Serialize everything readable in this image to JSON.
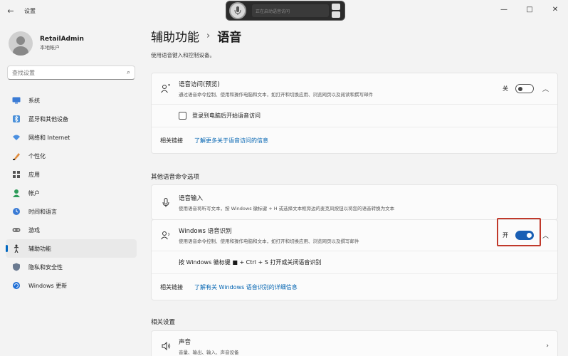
{
  "titlebar": {
    "back_icon": "←",
    "title": "设置",
    "minimize": "—",
    "maximize": "□",
    "close": "✕"
  },
  "voice_access_bar": {
    "status_text": "正在启动语音访问"
  },
  "profile": {
    "name": "RetailAdmin",
    "account_type": "本地帐户"
  },
  "search": {
    "placeholder": "查找设置"
  },
  "nav": {
    "items": [
      {
        "label": "系统",
        "icon": "system-icon"
      },
      {
        "label": "蓝牙和其他设备",
        "icon": "bluetooth-icon"
      },
      {
        "label": "网络和 Internet",
        "icon": "network-icon"
      },
      {
        "label": "个性化",
        "icon": "personalization-icon"
      },
      {
        "label": "应用",
        "icon": "apps-icon"
      },
      {
        "label": "帐户",
        "icon": "account-icon"
      },
      {
        "label": "时间和语言",
        "icon": "time-language-icon"
      },
      {
        "label": "游戏",
        "icon": "gaming-icon"
      },
      {
        "label": "辅助功能",
        "icon": "accessibility-icon"
      },
      {
        "label": "隐私和安全性",
        "icon": "privacy-icon"
      },
      {
        "label": "Windows 更新",
        "icon": "update-icon"
      }
    ],
    "active_index": 8
  },
  "main": {
    "breadcrumb_parent": "辅助功能",
    "breadcrumb_sep": "›",
    "breadcrumb_current": "语音",
    "description": "使用语音键入和控制设备。",
    "voice_access": {
      "title": "语音访问(预览)",
      "subtitle": "通过语音命令控制、使用和操作电脑和文本，如打开和切换应用、浏览网页以及阅读和撰写邮件",
      "toggle_label": "关",
      "toggle_state": "off",
      "checkbox_label": "登录到电脑后开始语音访问",
      "related_label": "相关链接",
      "related_link": "了解更多关于语音访问的信息"
    },
    "other_section_title": "其他语音命令选项",
    "voice_typing": {
      "title": "语音输入",
      "subtitle": "使用语音将听写文本，按 Windows 徽标键 + H 或选择文本框旁边的麦克风按钮以将您的语音转换为文本"
    },
    "windows_speech": {
      "title": "Windows 语音识别",
      "subtitle": "使用语音命令控制、使用和操作电脑和文本，如打开和切换应用、浏览网页以及撰写邮件",
      "toggle_label": "开",
      "toggle_state": "on",
      "shortcut_text": "按 Windows 徽标键 ■ + Ctrl + S 打开或关闭语音识别",
      "related_label": "相关链接",
      "related_link": "了解有关 Windows 语音识别的详细信息"
    },
    "related_settings_title": "相关设置",
    "sound": {
      "title": "声音",
      "subtitle": "音量、输出、输入、声音设备"
    }
  },
  "colors": {
    "accent": "#1a5fb4",
    "highlight": "#c0392b",
    "link": "#0063b1"
  }
}
